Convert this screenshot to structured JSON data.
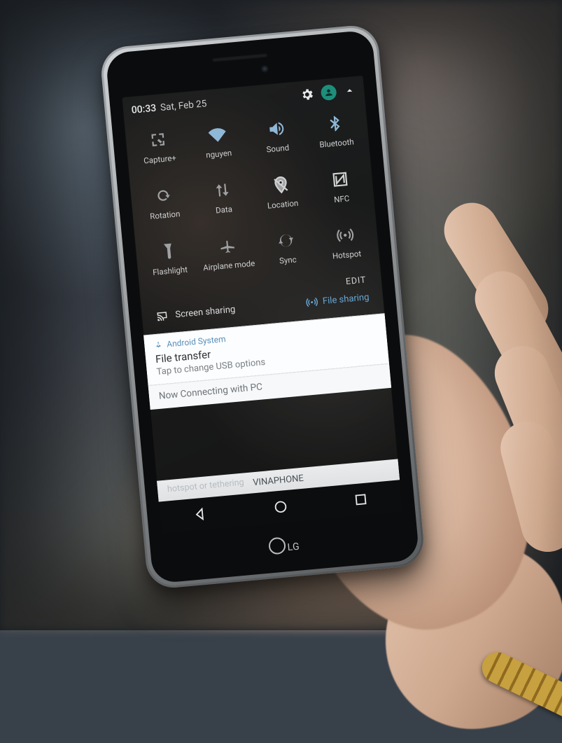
{
  "statusbar": {
    "time": "00:33",
    "date": "Sat, Feb 25"
  },
  "qs": {
    "tiles": [
      {
        "name": "capture-plus",
        "label": "Capture+",
        "on": false
      },
      {
        "name": "wifi",
        "label": "nguyen",
        "on": true
      },
      {
        "name": "sound",
        "label": "Sound",
        "on": true
      },
      {
        "name": "bluetooth",
        "label": "Bluetooth",
        "on": true
      },
      {
        "name": "rotation",
        "label": "Rotation",
        "on": false
      },
      {
        "name": "data",
        "label": "Data",
        "on": false
      },
      {
        "name": "location",
        "label": "Location",
        "on": false
      },
      {
        "name": "nfc",
        "label": "NFC",
        "on": false
      },
      {
        "name": "flashlight",
        "label": "Flashlight",
        "on": false
      },
      {
        "name": "airplane",
        "label": "Airplane mode",
        "on": false
      },
      {
        "name": "sync",
        "label": "Sync",
        "on": false
      },
      {
        "name": "hotspot",
        "label": "Hotspot",
        "on": false
      }
    ],
    "edit_label": "EDIT"
  },
  "sharebar": {
    "screen_sharing": "Screen sharing",
    "file_sharing": "File sharing"
  },
  "notifications": {
    "primary": {
      "source": "Android System",
      "title": "File transfer",
      "subtitle": "Tap to change USB options"
    },
    "secondary": {
      "text": "Now Connecting with PC"
    }
  },
  "carrier": {
    "behind_text": "hotspot or tethering",
    "name": "VINAPHONE"
  },
  "brand": "LG"
}
